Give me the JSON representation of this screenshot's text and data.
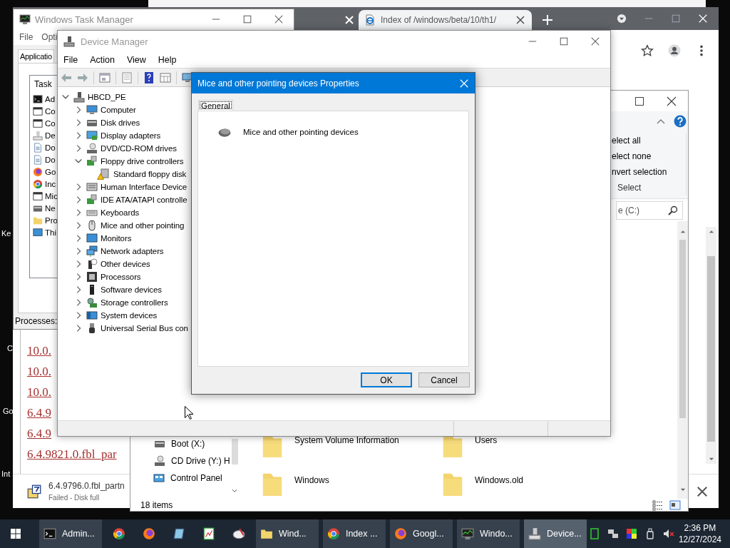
{
  "desktop_icons": [
    {
      "label": "Ke"
    },
    {
      "label": "C"
    },
    {
      "label": "Go"
    },
    {
      "label": "Int"
    }
  ],
  "browser": {
    "tab": {
      "title": "Index of /windows/beta/10/th1/",
      "selected": true
    },
    "links": [
      "10.0.",
      "10.0.",
      "10.0.",
      "6.4.9",
      "6.4.9",
      "6.4.9821.0.fbl_par"
    ],
    "download": {
      "file": "6.4.9796.0.fbl_partn",
      "status": "Failed - Disk full"
    }
  },
  "explorer": {
    "ribbon_commands": [
      "elect all",
      "elect none",
      "nvert selection"
    ],
    "ribbon_group": "Select",
    "search": {
      "placeholder": "e (C:)"
    },
    "nav_items": [
      {
        "label": "Boot (X:)",
        "kind": "drive"
      },
      {
        "label": "CD Drive (Y:) H",
        "kind": "cd"
      },
      {
        "label": "Control Panel",
        "kind": "control"
      }
    ],
    "files": [
      {
        "name": "System Volume Information"
      },
      {
        "name": "Users"
      },
      {
        "name": "Windows"
      },
      {
        "name": "Windows.old"
      }
    ],
    "status_bar": "18 items"
  },
  "task_manager": {
    "title": "Windows Task Manager",
    "menu": [
      "File",
      "Opti"
    ],
    "tab": {
      "label": "Applicatio",
      "selected": true
    },
    "column": "Task",
    "tasks": [
      {
        "label": "Ad",
        "kind": "cmd"
      },
      {
        "label": "Co",
        "kind": "window"
      },
      {
        "label": "Co",
        "kind": "window"
      },
      {
        "label": "De",
        "kind": "devmgr"
      },
      {
        "label": "Do",
        "kind": "doc"
      },
      {
        "label": "Do",
        "kind": "doc"
      },
      {
        "label": "Go",
        "kind": "firefox"
      },
      {
        "label": "Inc",
        "kind": "chrome"
      },
      {
        "label": "Mic",
        "kind": "window"
      },
      {
        "label": "Ne",
        "kind": "disk"
      },
      {
        "label": "Pro",
        "kind": "folder"
      },
      {
        "label": "Thi",
        "kind": "monitor"
      }
    ],
    "status_bar": "Processes:"
  },
  "device_manager": {
    "title": "Device Manager",
    "menu": [
      "File",
      "Action",
      "View",
      "Help"
    ],
    "tree": [
      {
        "label": "HBCD_PE",
        "kind": "root",
        "expanded": true,
        "children": [
          {
            "label": "Computer",
            "kind": "computer",
            "expanded": false
          },
          {
            "label": "Disk drives",
            "kind": "disk",
            "expanded": false
          },
          {
            "label": "Display adapters",
            "kind": "display",
            "expanded": false
          },
          {
            "label": "DVD/CD-ROM drives",
            "kind": "dvd",
            "expanded": false
          },
          {
            "label": "Floppy drive controllers",
            "kind": "board",
            "expanded": true,
            "children": [
              {
                "label": "Standard floppy disk",
                "kind": "floppy",
                "warning": true
              }
            ]
          },
          {
            "label": "Human Interface Device",
            "kind": "hid",
            "expanded": false
          },
          {
            "label": "IDE ATA/ATAPI controlle",
            "kind": "board",
            "expanded": false
          },
          {
            "label": "Keyboards",
            "kind": "keyboard",
            "expanded": false
          },
          {
            "label": "Mice and other pointing",
            "kind": "mouse",
            "expanded": false
          },
          {
            "label": "Monitors",
            "kind": "monitor",
            "expanded": false
          },
          {
            "label": "Network adapters",
            "kind": "network",
            "expanded": false
          },
          {
            "label": "Other devices",
            "kind": "other",
            "expanded": false
          },
          {
            "label": "Processors",
            "kind": "cpu",
            "expanded": false
          },
          {
            "label": "Software devices",
            "kind": "software",
            "expanded": false
          },
          {
            "label": "Storage controllers",
            "kind": "storage",
            "expanded": false
          },
          {
            "label": "System devices",
            "kind": "system",
            "expanded": false
          },
          {
            "label": "Universal Serial Bus con",
            "kind": "usb",
            "expanded": false
          }
        ]
      }
    ]
  },
  "dialog": {
    "title": "Mice and other pointing devices Properties",
    "tabs": [
      {
        "label": "General",
        "selected": true
      }
    ],
    "device": {
      "name": "Mice and other pointing devices",
      "kind": "mouse"
    },
    "buttons": [
      {
        "label": "OK",
        "default": true
      },
      {
        "label": "Cancel",
        "default": false
      }
    ]
  },
  "taskbar": {
    "items": [
      {
        "label": "Admin...",
        "kind": "cmd",
        "selected": false
      },
      {
        "kind": "chrome",
        "selected": false
      },
      {
        "kind": "firefox",
        "selected": false
      },
      {
        "kind": "notepad",
        "selected": false
      },
      {
        "kind": "editor",
        "selected": false
      },
      {
        "kind": "paint",
        "selected": false
      },
      {
        "label": "Wind...",
        "kind": "folder",
        "selected": false
      },
      {
        "label": "Index ...",
        "kind": "chrome",
        "selected": false
      },
      {
        "label": "Googl...",
        "kind": "firefox",
        "selected": false
      },
      {
        "label": "Windo...",
        "kind": "taskmgr",
        "selected": false
      },
      {
        "label": "Device...",
        "kind": "devmgr",
        "selected": true
      }
    ],
    "clock": {
      "time": "2:36 PM",
      "date": "12/27/2024"
    }
  }
}
